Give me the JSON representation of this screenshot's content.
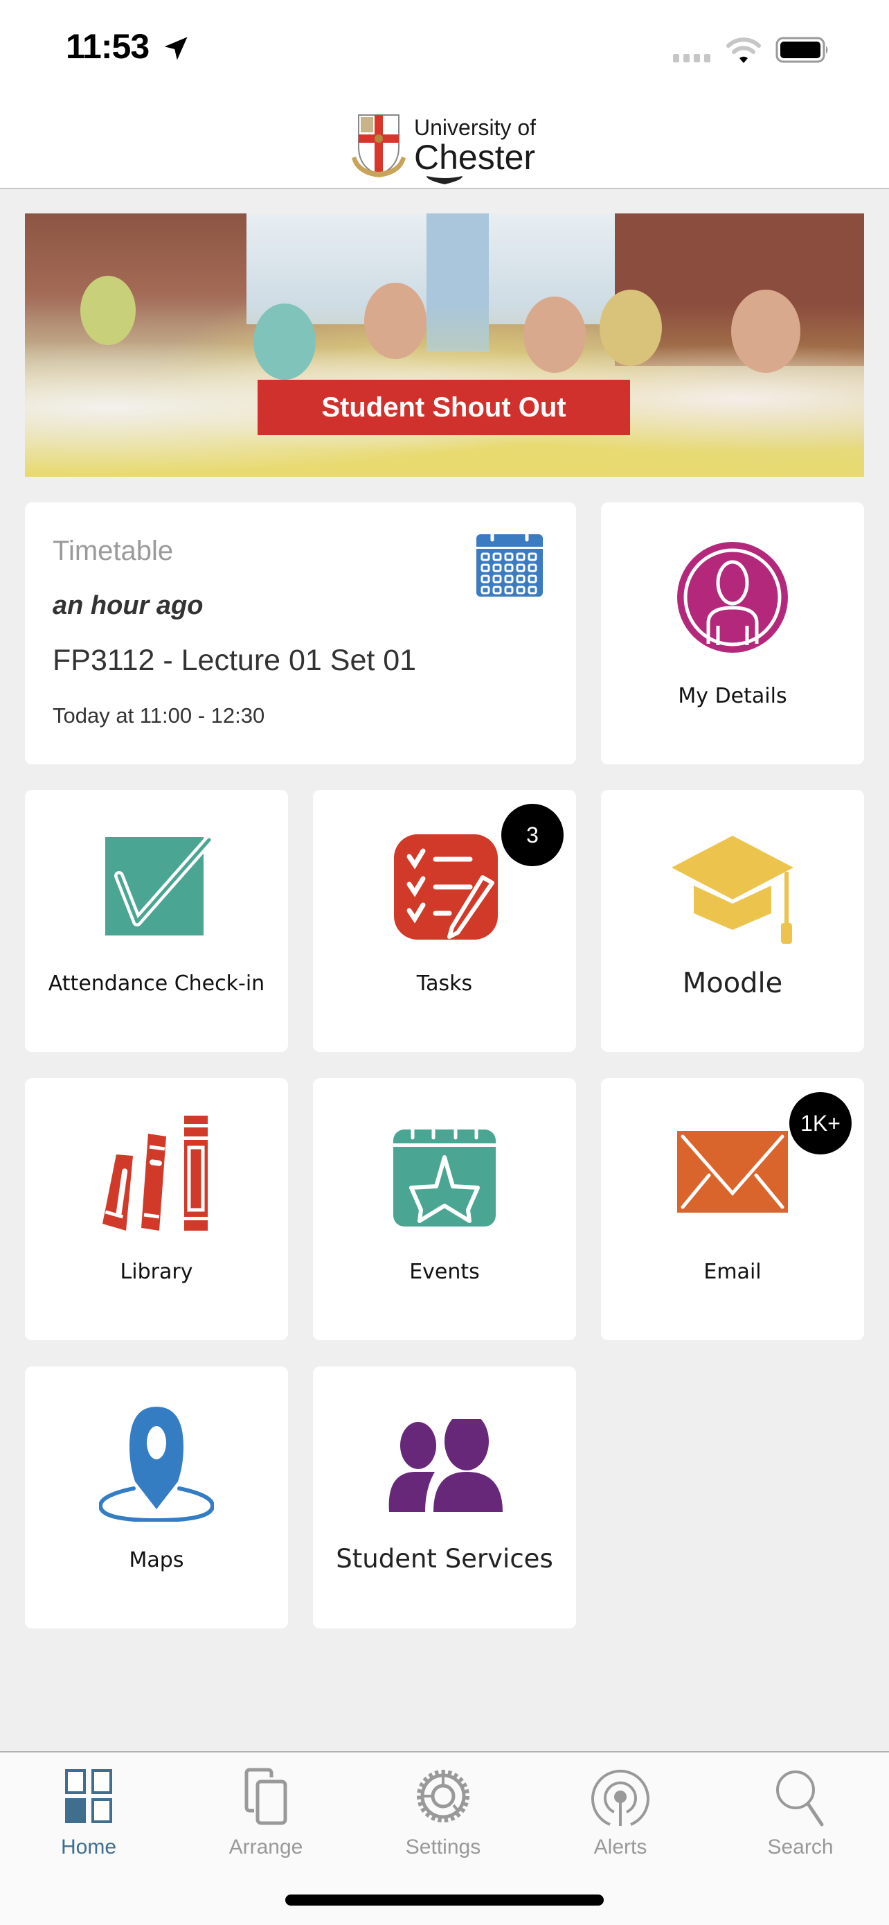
{
  "status_bar": {
    "time": "11:53",
    "location_icon": "location-arrow-icon",
    "signal_icon": "cellular-signal-icon",
    "wifi_icon": "wifi-icon",
    "battery_icon": "battery-full-icon"
  },
  "header": {
    "logo_line1": "University of",
    "logo_line2": "Chester",
    "logo_icon": "university-crest-icon",
    "pull_handle_icon": "chevron-down-icon"
  },
  "banner": {
    "label": "Student Shout Out",
    "label_color": "#d0312d"
  },
  "timetable": {
    "title": "Timetable",
    "updated": "an hour ago",
    "event": "FP3112 - Lecture 01 Set 01",
    "time": "Today at 11:00 - 12:30",
    "icon": "calendar-icon",
    "icon_color": "#3a7bc2"
  },
  "tiles": [
    {
      "label": "My Details",
      "icon": "user-circle-icon",
      "color": "#b3287b"
    },
    {
      "label": "Attendance Check-in",
      "icon": "checkmark-icon",
      "color": "#4aa593"
    },
    {
      "label": "Tasks",
      "icon": "task-list-icon",
      "color": "#d13a28",
      "badge": "3"
    },
    {
      "label": "Moodle",
      "icon": "graduation-cap-icon",
      "color": "#ecc44d"
    },
    {
      "label": "Library",
      "icon": "books-icon",
      "color": "#d13a28"
    },
    {
      "label": "Events",
      "icon": "calendar-star-icon",
      "color": "#4aa593"
    },
    {
      "label": "Email",
      "icon": "envelope-icon",
      "color": "#d9652c",
      "badge": "1K+"
    },
    {
      "label": "Maps",
      "icon": "map-pin-icon",
      "color": "#357dc3"
    },
    {
      "label": "Student Services",
      "icon": "people-icon",
      "color": "#67287a"
    }
  ],
  "tabbar": {
    "active_color": "#3f6e8f",
    "inactive_color": "#999999",
    "tabs": [
      {
        "label": "Home",
        "icon": "grid-icon",
        "active": true
      },
      {
        "label": "Arrange",
        "icon": "copy-icon",
        "active": false
      },
      {
        "label": "Settings",
        "icon": "gear-icon",
        "active": false
      },
      {
        "label": "Alerts",
        "icon": "broadcast-icon",
        "active": false
      },
      {
        "label": "Search",
        "icon": "search-icon",
        "active": false
      }
    ]
  }
}
